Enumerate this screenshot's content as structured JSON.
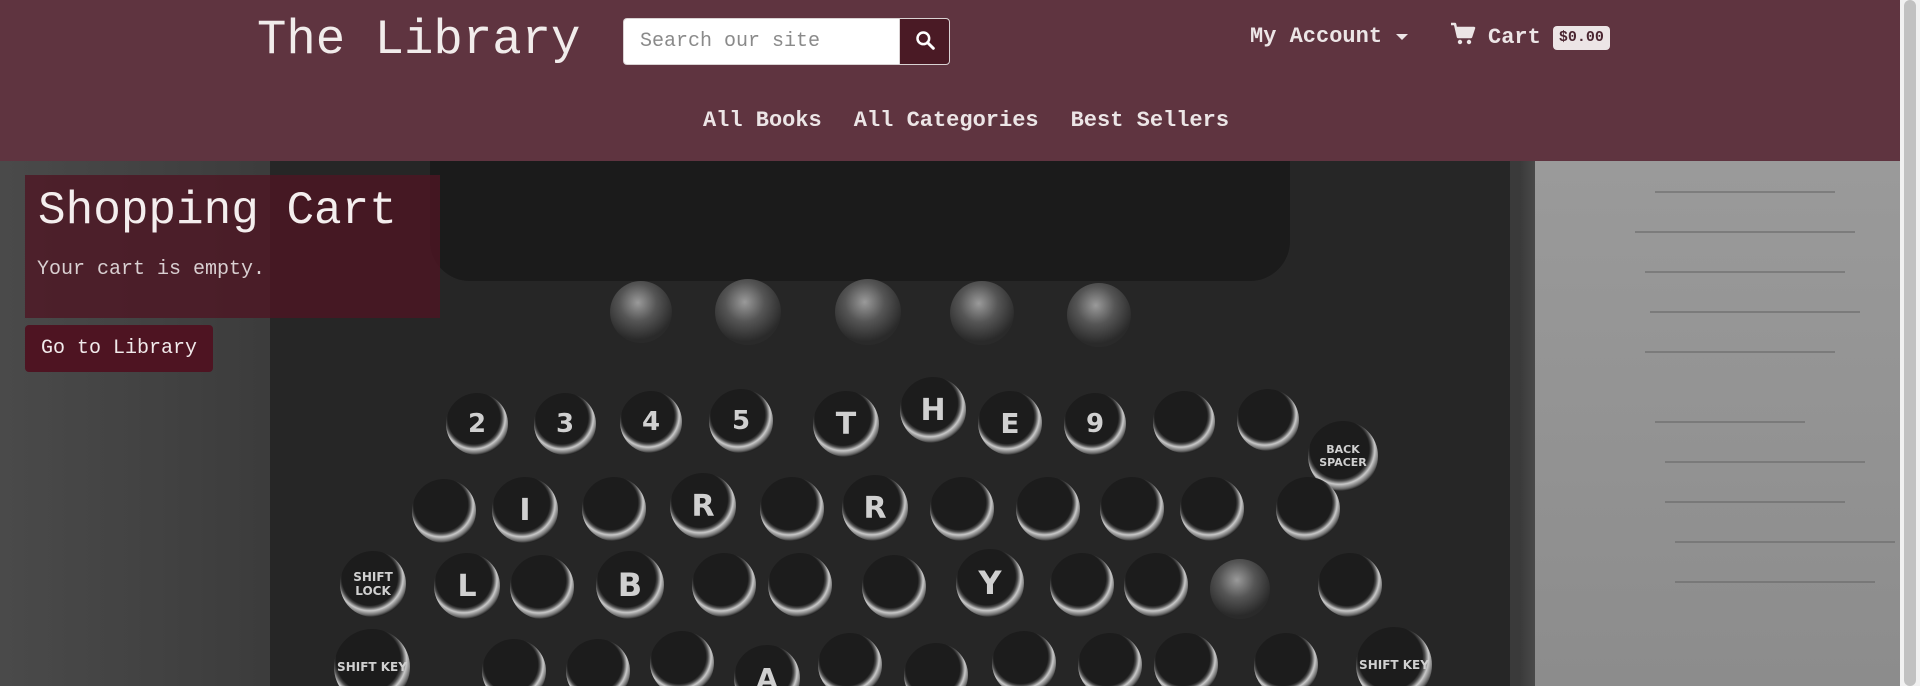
{
  "header": {
    "brand": "The Library",
    "search": {
      "placeholder": "Search our site",
      "value": ""
    },
    "account_label": "My Account",
    "cart": {
      "label": "Cart",
      "total": "$0.00"
    }
  },
  "nav": {
    "items": [
      {
        "label": "All Books"
      },
      {
        "label": "All Categories"
      },
      {
        "label": "Best Sellers"
      }
    ]
  },
  "main": {
    "title": "Shopping Cart",
    "message": "Your cart is empty.",
    "cta_label": "Go to Library"
  },
  "colors": {
    "header_bg": "#5f3440",
    "accent_dark": "#4e1422",
    "text_light": "#ece5e6"
  },
  "icons": {
    "search": "search-icon",
    "cart": "cart-icon",
    "account_dropdown": "chevron-down-icon"
  },
  "background_keys": {
    "row1": [
      "2",
      "3",
      "4",
      "5",
      "T",
      "H",
      "E",
      "9",
      "",
      ""
    ],
    "row2": [
      "",
      "I",
      "",
      "R",
      "",
      "R",
      "",
      "",
      "",
      ""
    ],
    "row3": [
      "L",
      "",
      "B",
      "",
      "",
      "",
      "Y",
      "",
      "",
      ""
    ],
    "row4": [
      "",
      "",
      "",
      "A",
      "",
      "",
      "",
      "",
      ""
    ],
    "side_keys": {
      "back_spacer": "BACK SPACER",
      "shift_lock": "SHIFT LOCK",
      "shift_key": "SHIFT KEY"
    }
  }
}
